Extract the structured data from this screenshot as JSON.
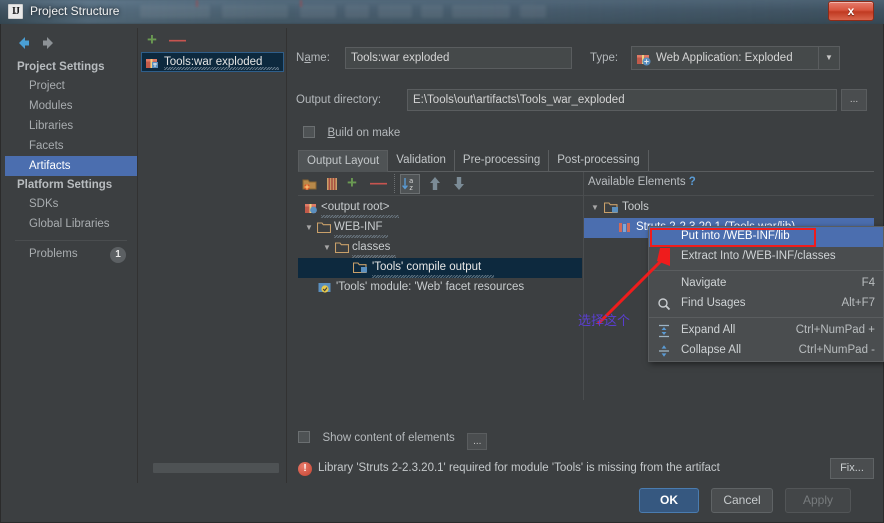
{
  "window": {
    "title": "Project Structure",
    "app_icon": "IJ",
    "close_label": "x"
  },
  "sidebar": {
    "nav": {
      "back_icon": "arrow-left-icon",
      "forward_icon": "arrow-right-icon"
    },
    "groups": [
      {
        "title": "Project Settings",
        "items": [
          {
            "label": "Project",
            "selected": false
          },
          {
            "label": "Modules",
            "selected": false
          },
          {
            "label": "Libraries",
            "selected": false
          },
          {
            "label": "Facets",
            "selected": false
          },
          {
            "label": "Artifacts",
            "selected": true
          }
        ]
      },
      {
        "title": "Platform Settings",
        "items": [
          {
            "label": "SDKs",
            "selected": false
          },
          {
            "label": "Global Libraries",
            "selected": false
          }
        ]
      }
    ],
    "problems": {
      "label": "Problems",
      "count": "1"
    }
  },
  "artifact_list": {
    "toolbar": {
      "add": "+",
      "remove": "—"
    },
    "items": [
      {
        "label": "Tools:war exploded",
        "icon": "artifact-icon",
        "selected": true
      }
    ]
  },
  "form": {
    "name_label": "Name:",
    "name_value": "Tools:war exploded",
    "type_label": "Type:",
    "type_value": "Web Application: Exploded",
    "output_dir_label": "Output directory:",
    "output_dir_value": "E:\\Tools\\out\\artifacts\\Tools_war_exploded",
    "browse_label": "...",
    "build_on_make_label": "Build on make",
    "build_on_make_checked": false
  },
  "tabs": [
    {
      "label": "Output Layout",
      "active": true
    },
    {
      "label": "Validation",
      "active": false
    },
    {
      "label": "Pre-processing",
      "active": false
    },
    {
      "label": "Post-processing",
      "active": false
    }
  ],
  "editor_toolbar": [
    {
      "name": "add-artifact-dir-icon"
    },
    {
      "name": "add-archive-icon"
    },
    {
      "name": "add-icon"
    },
    {
      "name": "remove-icon"
    },
    {
      "name": "sort-alpha-icon"
    },
    {
      "name": "move-up-icon"
    },
    {
      "name": "move-down-icon"
    }
  ],
  "output_tree": [
    {
      "label": "<output root>",
      "depth": 0,
      "twisty": "",
      "icon": "artifact-root-icon",
      "selected": false,
      "squiggle": true
    },
    {
      "label": "WEB-INF",
      "depth": 0,
      "twisty": "▼",
      "icon": "folder-icon",
      "selected": false,
      "squiggle": true
    },
    {
      "label": "classes",
      "depth": 1,
      "twisty": "▼",
      "icon": "folder-icon",
      "selected": false,
      "squiggle": true
    },
    {
      "label": "'Tools' compile output",
      "depth": 2,
      "twisty": "",
      "icon": "compile-output-icon",
      "selected": true,
      "squiggle": true
    },
    {
      "label": "'Tools' module: 'Web' facet resources",
      "depth": 1,
      "twisty": "",
      "icon": "facet-resources-icon",
      "selected": false,
      "squiggle": false
    }
  ],
  "available": {
    "header": "Available Elements",
    "help_icon": "?",
    "nodes": [
      {
        "label": "Tools",
        "depth": 0,
        "twisty": "▼",
        "icon": "module-icon",
        "selected": false
      },
      {
        "label": "Struts 2-2.3.20.1 (Tools.war/lib)",
        "depth": 1,
        "twisty": "",
        "icon": "library-icon",
        "selected": true
      }
    ]
  },
  "show_content": {
    "label": "Show content of elements",
    "checked": false,
    "options_label": "..."
  },
  "warning": {
    "text": "Library 'Struts 2-2.3.20.1' required for module 'Tools' is missing from the artifact",
    "icon": "error-icon",
    "fix_label": "Fix..."
  },
  "footer": {
    "ok": "OK",
    "cancel": "Cancel",
    "apply": "Apply"
  },
  "context_menu": {
    "items": [
      {
        "label": "Put into /WEB-INF/lib",
        "shortcut": "",
        "icon": "",
        "highlighted": true
      },
      {
        "label": "Extract Into /WEB-INF/classes",
        "shortcut": "",
        "icon": "",
        "highlighted": false
      },
      {
        "separator": true
      },
      {
        "label": "Navigate",
        "shortcut": "F4",
        "icon": "",
        "highlighted": false
      },
      {
        "label": "Find Usages",
        "shortcut": "Alt+F7",
        "icon": "search-icon",
        "highlighted": false
      },
      {
        "separator": true
      },
      {
        "label": "Expand All",
        "shortcut": "Ctrl+NumPad +",
        "icon": "expand-all-icon",
        "highlighted": false
      },
      {
        "label": "Collapse All",
        "shortcut": "Ctrl+NumPad -",
        "icon": "collapse-all-icon",
        "highlighted": false
      }
    ]
  },
  "annotation": {
    "note_text": "选择这个",
    "note_color": "#5a3fd0",
    "highlight_color": "#ef1c1c"
  },
  "colors": {
    "panel_bg": "#3c3f41",
    "selection_blue": "#4b6eaf",
    "tree_selection": "#0d293e",
    "accent_green": "#6a9a52",
    "accent_red": "#c75450"
  }
}
